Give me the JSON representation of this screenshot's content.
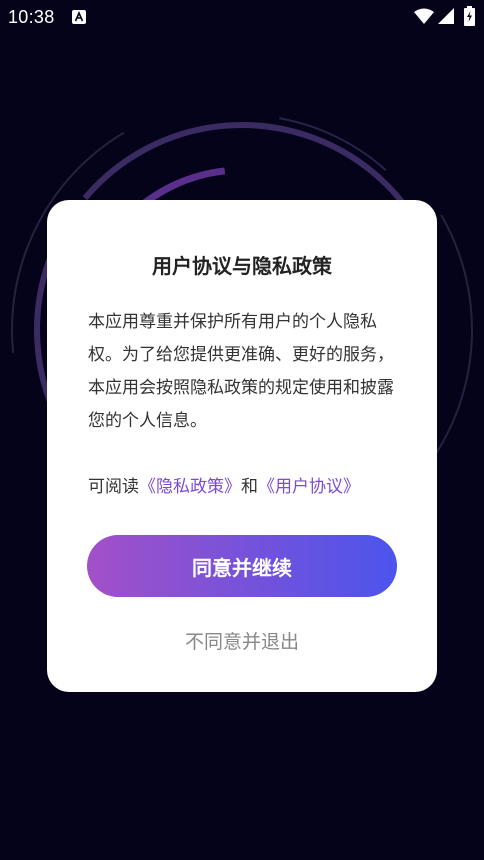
{
  "status_bar": {
    "time": "10:38",
    "icons": [
      "notification-a-icon",
      "wifi-icon",
      "signal-icon",
      "battery-charging-icon"
    ]
  },
  "dialog": {
    "title": "用户协议与隐私政策",
    "body": "本应用尊重并保护所有用户的个人隐私权。为了给您提供更准确、更好的服务，本应用会按照隐私政策的规定使用和披露您的个人信息。",
    "links": {
      "prefix": "可阅读",
      "privacy_policy": "《隐私政策》",
      "conjunction": "和",
      "user_agreement": "《用户协议》"
    },
    "agree_label": "同意并继续",
    "decline_label": "不同意并退出"
  },
  "colors": {
    "background": "#05031a",
    "dialog": "#ffffff",
    "link": "#7b4bd6",
    "button_gradient_start": "#a350c8",
    "button_gradient_end": "#4c54ec",
    "decline_text": "#888888"
  }
}
